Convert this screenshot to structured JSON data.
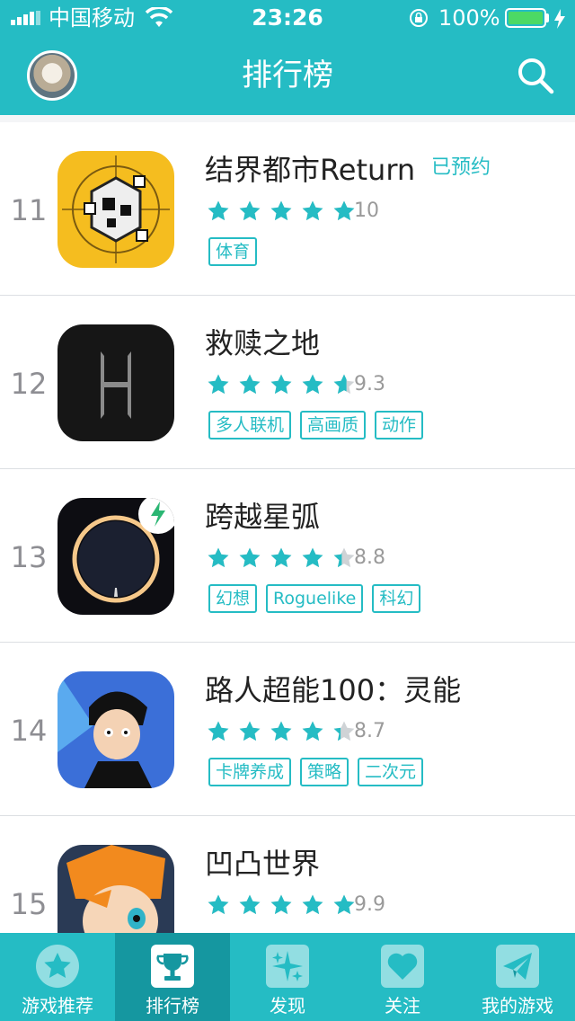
{
  "status_bar": {
    "carrier": "中国移动",
    "time": "23:26",
    "battery": "100%"
  },
  "header": {
    "title": "排行榜",
    "avatar_icon": "user-avatar",
    "search_icon": "search-icon"
  },
  "colors": {
    "accent": "#25bcc4",
    "active_tab": "#1597a0",
    "text": "#222222",
    "muted": "#9a9a9a",
    "star_empty": "#cfd3d6"
  },
  "games": [
    {
      "rank": "11",
      "name": "结界都市Return",
      "status": "已预约",
      "score": "10",
      "rating": 5.0,
      "tags": [
        "体育"
      ]
    },
    {
      "rank": "12",
      "name": "救赎之地",
      "status": "",
      "score": "9.3",
      "rating": 4.6,
      "tags": [
        "多人联机",
        "高画质",
        "动作"
      ]
    },
    {
      "rank": "13",
      "name": "跨越星弧",
      "status": "",
      "score": "8.8",
      "rating": 4.4,
      "tags": [
        "幻想",
        "Roguelike",
        "科幻"
      ]
    },
    {
      "rank": "14",
      "name": "路人超能100：灵能",
      "status": "",
      "score": "8.7",
      "rating": 4.35,
      "tags": [
        "卡牌养成",
        "策略",
        "二次元"
      ]
    },
    {
      "rank": "15",
      "name": "凹凸世界",
      "status": "",
      "score": "9.9",
      "rating": 5.0,
      "tags": []
    }
  ],
  "tabbar": {
    "tabs": [
      {
        "label": "游戏推荐",
        "icon": "star-icon"
      },
      {
        "label": "排行榜",
        "icon": "trophy-icon"
      },
      {
        "label": "发现",
        "icon": "sparkle-icon"
      },
      {
        "label": "关注",
        "icon": "heart-icon"
      },
      {
        "label": "我的游戏",
        "icon": "paper-plane-icon"
      }
    ],
    "active": "排行榜"
  }
}
